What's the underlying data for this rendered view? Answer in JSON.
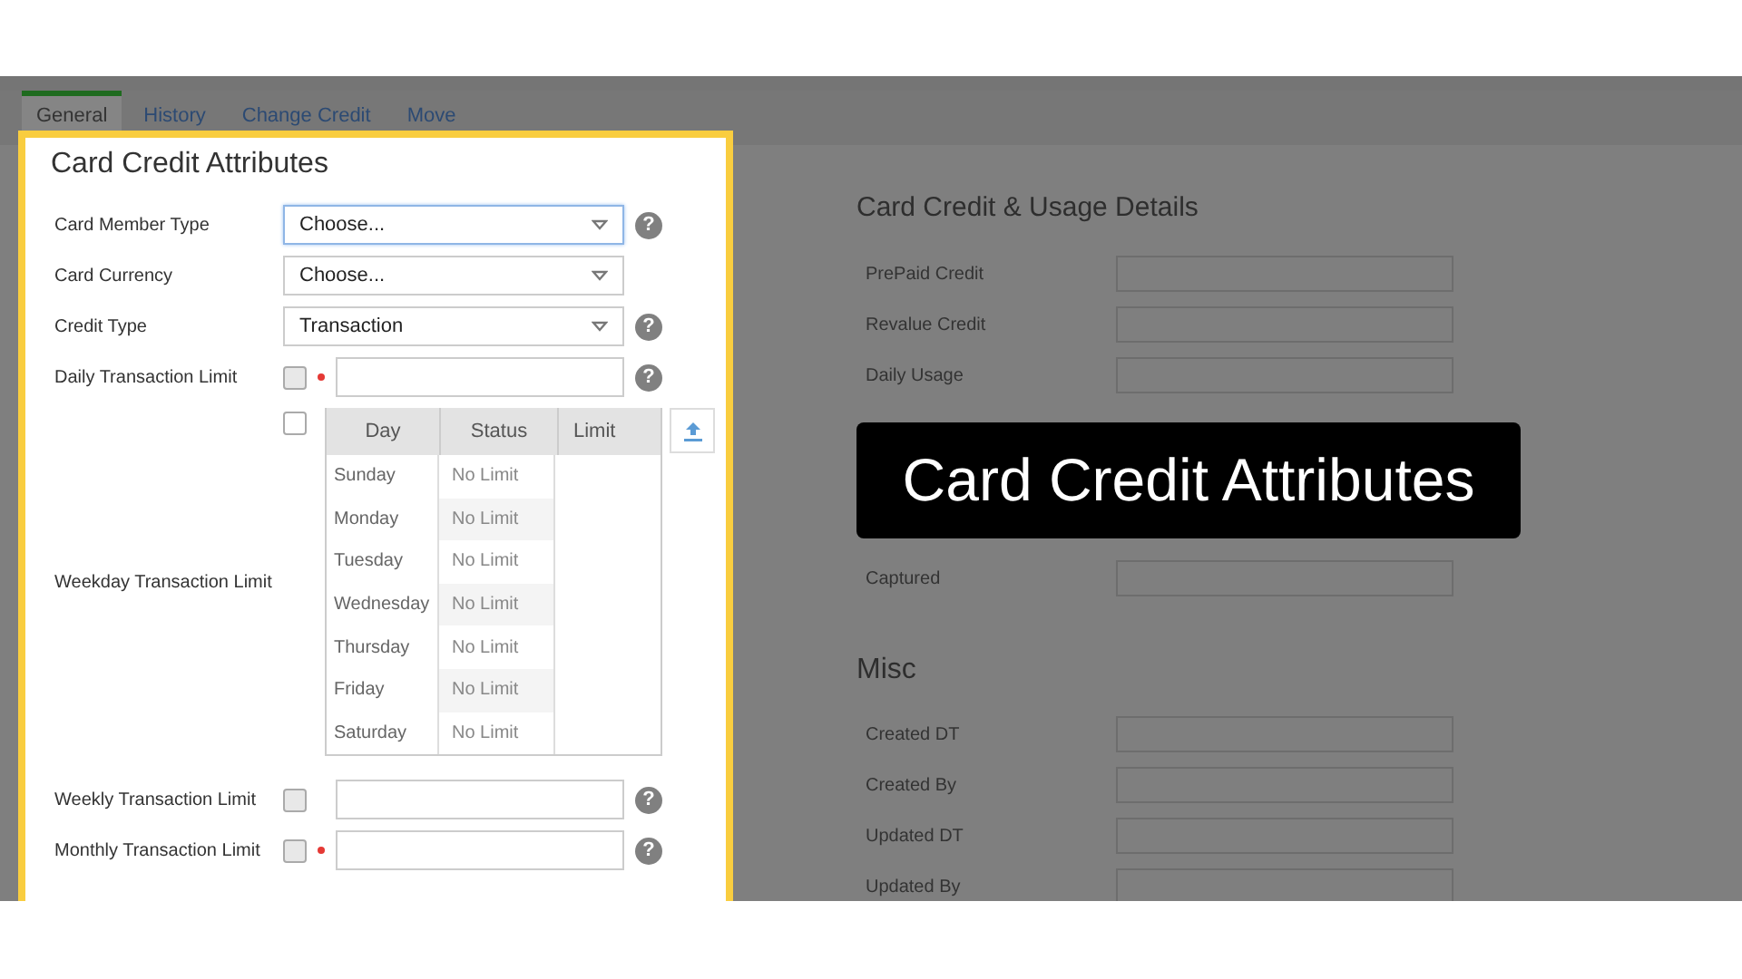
{
  "tabs": [
    {
      "label": "General",
      "selected": true
    },
    {
      "label": "History",
      "selected": false
    },
    {
      "label": "Change Credit",
      "selected": false
    },
    {
      "label": "Move",
      "selected": false
    }
  ],
  "attributes": {
    "title": "Card Credit Attributes",
    "rows": [
      {
        "kind": "select",
        "label": "Card Member Type",
        "value": "Choose...",
        "focused": true,
        "help": "?"
      },
      {
        "kind": "select",
        "label": "Card Currency",
        "value": "Choose...",
        "focused": false
      },
      {
        "kind": "select",
        "label": "Credit Type",
        "value": "Transaction",
        "focused": false,
        "help": "?"
      },
      {
        "kind": "limit",
        "label": "Daily Transaction Limit",
        "checked": false,
        "required": true,
        "help": "?"
      },
      {
        "kind": "table",
        "label": "Weekday Transaction Limit",
        "checked": false,
        "columns": [
          "Day",
          "Status",
          "Limit"
        ],
        "rows": [
          {
            "day": "Sunday",
            "status": "No Limit"
          },
          {
            "day": "Monday",
            "status": "No Limit"
          },
          {
            "day": "Tuesday",
            "status": "No Limit"
          },
          {
            "day": "Wednesday",
            "status": "No Limit"
          },
          {
            "day": "Thursday",
            "status": "No Limit"
          },
          {
            "day": "Friday",
            "status": "No Limit"
          },
          {
            "day": "Saturday",
            "status": "No Limit"
          }
        ]
      },
      {
        "kind": "limit",
        "label": "Weekly Transaction Limit",
        "checked": false,
        "help": "?"
      },
      {
        "kind": "limit",
        "label": "Monthly Transaction Limit",
        "checked": false,
        "required": true,
        "help": "?"
      }
    ]
  },
  "usage": {
    "title": "Card Credit & Usage Details",
    "fields_top": [
      "PrePaid Credit",
      "Revalue Credit",
      "Daily Usage"
    ],
    "fields_bottom": [
      "Captured"
    ]
  },
  "misc": {
    "title": "Misc",
    "fields": [
      "Created DT",
      "Created By",
      "Updated DT",
      "Updated By"
    ]
  },
  "caption": "Card Credit Attributes"
}
